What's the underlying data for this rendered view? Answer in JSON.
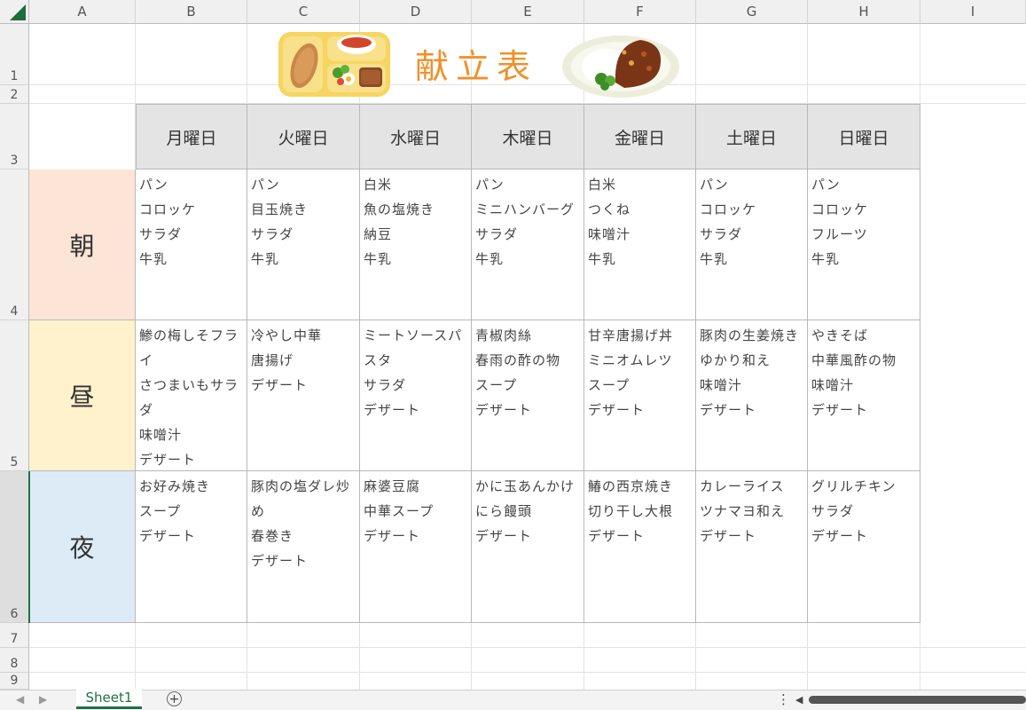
{
  "columns": [
    "A",
    "B",
    "C",
    "D",
    "E",
    "F",
    "G",
    "H",
    "I"
  ],
  "rows": [
    "1",
    "2",
    "3",
    "4",
    "5",
    "6",
    "7",
    "8",
    "9"
  ],
  "title": "献立表",
  "days": [
    "月曜日",
    "火曜日",
    "水曜日",
    "木曜日",
    "金曜日",
    "土曜日",
    "日曜日"
  ],
  "meals": [
    {
      "label": "朝",
      "color": "#fce4d6",
      "days": [
        [
          "パン",
          "コロッケ",
          "サラダ",
          "牛乳"
        ],
        [
          "パン",
          "目玉焼き",
          "サラダ",
          "牛乳"
        ],
        [
          "白米",
          "魚の塩焼き",
          "納豆",
          "牛乳"
        ],
        [
          "パン",
          "ミニハンバーグ",
          "サラダ",
          "牛乳"
        ],
        [
          "白米",
          "つくね",
          "味噌汁",
          "牛乳"
        ],
        [
          "パン",
          "コロッケ",
          "サラダ",
          "牛乳"
        ],
        [
          "パン",
          "コロッケ",
          "フルーツ",
          "牛乳"
        ]
      ]
    },
    {
      "label": "昼",
      "color": "#fff2cc",
      "days": [
        [
          "鯵の梅しそフラ",
          "イ",
          "さつまいもサラ",
          "ダ",
          "味噌汁",
          "デザート"
        ],
        [
          "冷やし中華",
          "唐揚げ",
          "デザート"
        ],
        [
          "ミートソースパ",
          "スタ",
          "サラダ",
          "デザート"
        ],
        [
          "青椒肉絲",
          "春雨の酢の物",
          "スープ",
          "デザート"
        ],
        [
          "甘辛唐揚げ丼",
          "ミニオムレツ",
          "スープ",
          "デザート"
        ],
        [
          "豚肉の生姜焼き",
          "ゆかり和え",
          "味噌汁",
          "デザート"
        ],
        [
          "やきそば",
          "中華風酢の物",
          "味噌汁",
          "デザート"
        ]
      ]
    },
    {
      "label": "夜",
      "color": "#ddebf7",
      "days": [
        [
          "お好み焼き",
          "スープ",
          "デザート"
        ],
        [
          "豚肉の塩ダレ炒",
          "め",
          "春巻き",
          "デザート"
        ],
        [
          "麻婆豆腐",
          "中華スープ",
          "デザート"
        ],
        [
          "かに玉あんかけ",
          "にら饅頭",
          "デザート"
        ],
        [
          "鰆の西京焼き",
          "切り干し大根",
          "デザート"
        ],
        [
          "カレーライス",
          "ツナマヨ和え",
          "デザート"
        ],
        [
          "グリルチキン",
          "サラダ",
          "デザート"
        ]
      ]
    }
  ],
  "sheet_tab": "Sheet1",
  "icons": [
    "excel-corner-icon",
    "bento-tray-icon",
    "curry-plate-icon",
    "scroll-left-icon",
    "scroll-right-icon",
    "add-sheet-icon",
    "more-options-icon"
  ]
}
